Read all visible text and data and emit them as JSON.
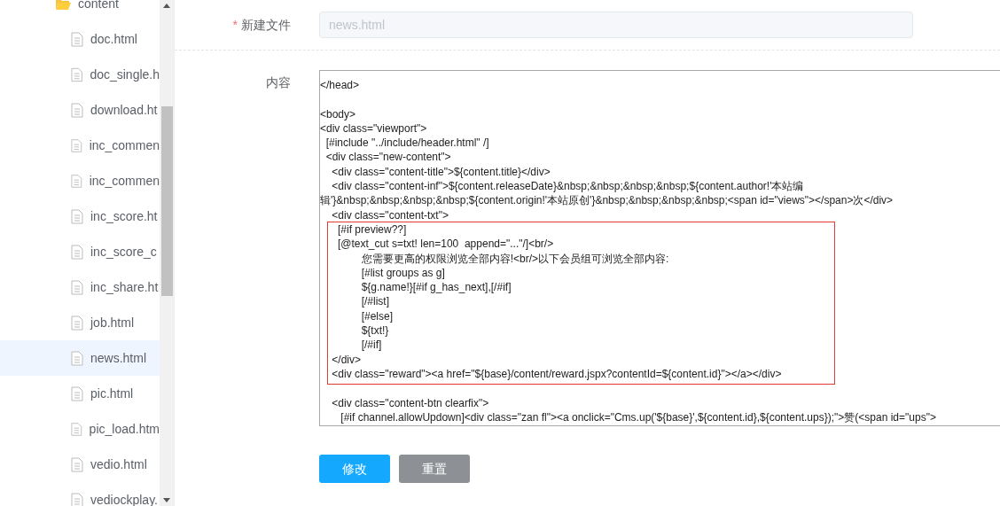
{
  "file_tree": [
    {
      "kind": "folder",
      "label": "content",
      "selected": false
    },
    {
      "kind": "file",
      "label": "doc.html",
      "selected": false
    },
    {
      "kind": "file",
      "label": "doc_single.h",
      "selected": false
    },
    {
      "kind": "file",
      "label": "download.ht",
      "selected": false
    },
    {
      "kind": "file",
      "label": "inc_commen",
      "selected": false
    },
    {
      "kind": "file",
      "label": "inc_commen",
      "selected": false
    },
    {
      "kind": "file",
      "label": "inc_score.ht",
      "selected": false
    },
    {
      "kind": "file",
      "label": "inc_score_c",
      "selected": false
    },
    {
      "kind": "file",
      "label": "inc_share.ht",
      "selected": false
    },
    {
      "kind": "file",
      "label": "job.html",
      "selected": false
    },
    {
      "kind": "file",
      "label": "news.html",
      "selected": true
    },
    {
      "kind": "file",
      "label": "pic.html",
      "selected": false
    },
    {
      "kind": "file",
      "label": "pic_load.htm",
      "selected": false
    },
    {
      "kind": "file",
      "label": "vedio.html",
      "selected": false
    },
    {
      "kind": "file",
      "label": "vediockplay.",
      "selected": false
    }
  ],
  "form": {
    "filename": {
      "label": "新建文件",
      "required_mark": "*",
      "value": "news.html",
      "disabled": true
    },
    "content": {
      "label": "内容",
      "lines": [
        {
          "text": "</head>"
        },
        {
          "text": "<body>",
          "blank_before": true
        },
        {
          "text": "<div class=\"viewport\">"
        },
        {
          "text": "  [#include \"../include/header.html\" /]"
        },
        {
          "text": "  <div class=\"new-content\">"
        },
        {
          "text": "    <div class=\"content-title\">${content.title}</div>"
        },
        {
          "text": "    <div class=\"content-inf\">${content.releaseDate}&nbsp;&nbsp;&nbsp;&nbsp;${content.author!'本站编"
        },
        {
          "text": "辑'}&nbsp;&nbsp;&nbsp;&nbsp;${content.origin!'本站原创'}&nbsp;&nbsp;&nbsp;&nbsp;<span id=\"views\"></span>次</div>"
        },
        {
          "text": "    <div class=\"content-txt\">"
        },
        {
          "text": "      [#if preview??]"
        },
        {
          "text": "      [@text_cut s=txt! len=100  append=\"...\"/]<br/>"
        },
        {
          "text": "              您需要更高的权限浏览全部内容!<br/>以下会员组可浏览全部内容:"
        },
        {
          "text": "              [#list groups as g]"
        },
        {
          "text": "              ${g.name!}[#if g_has_next],[/#if]"
        },
        {
          "text": "              [/#list]"
        },
        {
          "text": "              [#else]"
        },
        {
          "text": "              ${txt!}"
        },
        {
          "text": "              [/#if]"
        },
        {
          "text": "    </div>"
        },
        {
          "text": "    <div class=\"reward\"><a href=\"${base}/content/reward.jspx?contentId=${content.id}\"></a></div>"
        },
        {
          "text": "    <div class=\"content-btn clearfix\">",
          "blank_before": true
        },
        {
          "text": "       [#if channel.allowUpdown]<div class=\"zan fl\"><a onclick=\"Cms.up('${base}',${content.id},${content.ups});\">赞(<span id=\"ups\">"
        }
      ]
    }
  },
  "buttons": [
    {
      "kind": "primary",
      "label": "修改"
    },
    {
      "kind": "secondary",
      "label": "重置"
    }
  ]
}
